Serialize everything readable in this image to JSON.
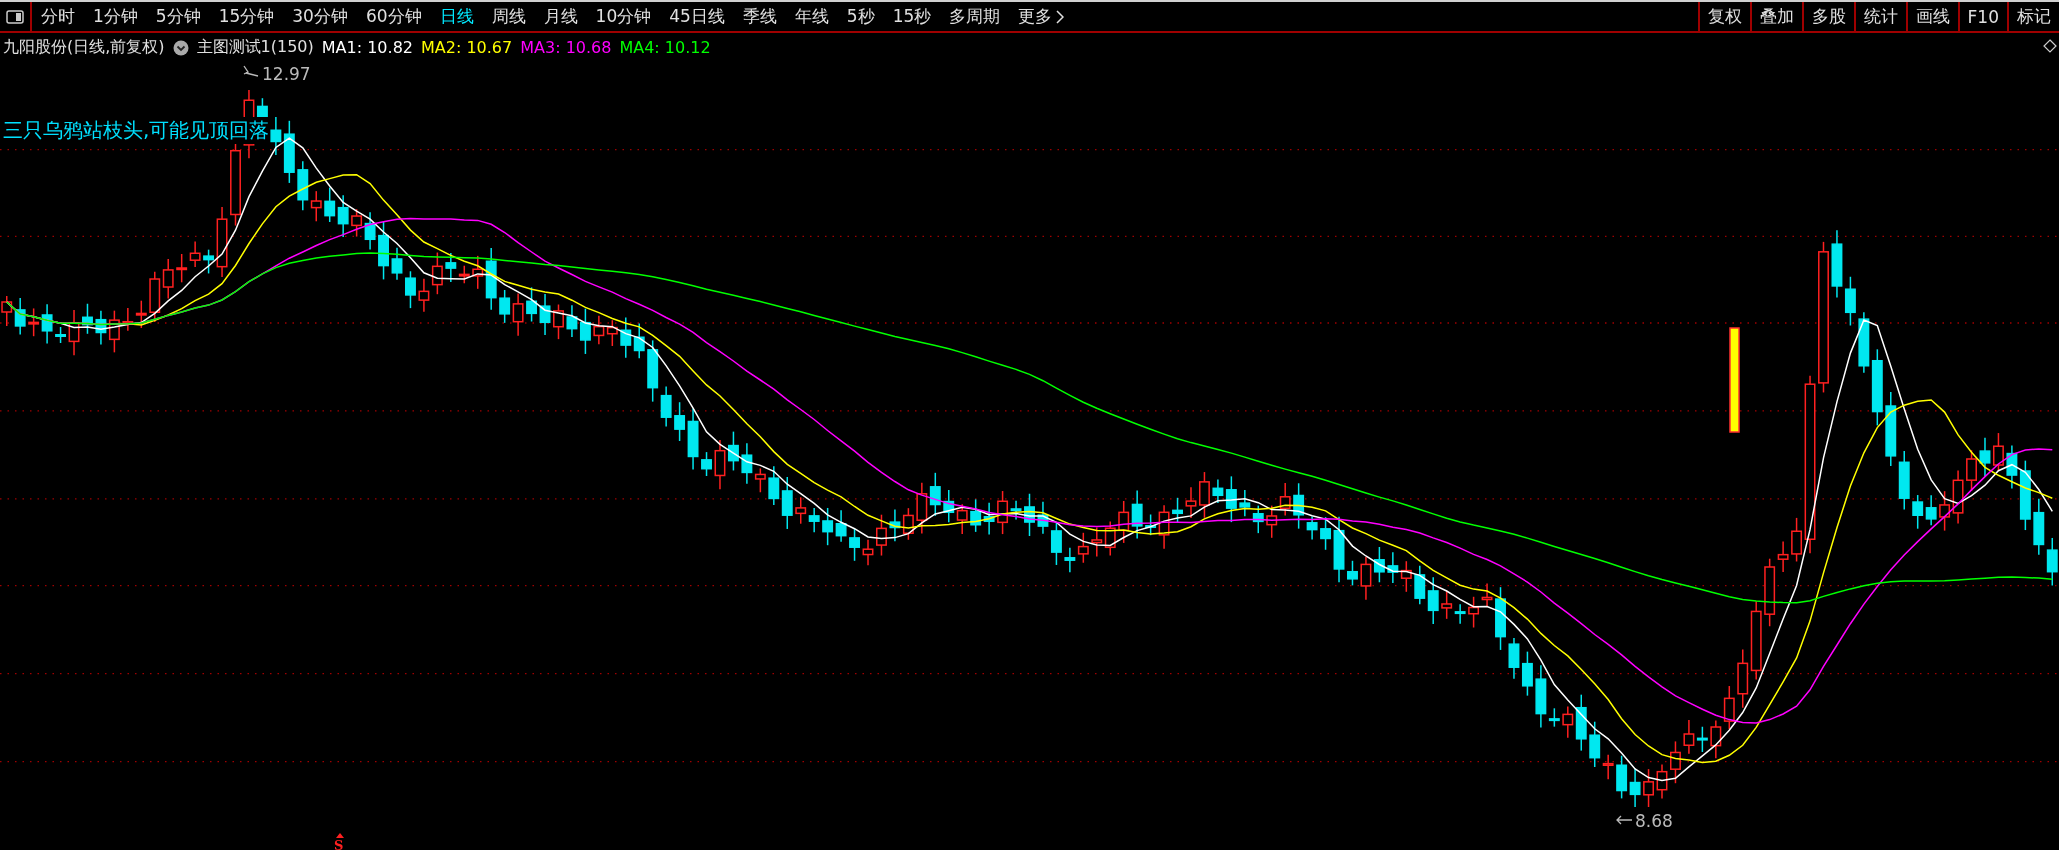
{
  "toolbar": {
    "periods": [
      {
        "label": "分时",
        "selected": false
      },
      {
        "label": "1分钟",
        "selected": false
      },
      {
        "label": "5分钟",
        "selected": false
      },
      {
        "label": "15分钟",
        "selected": false
      },
      {
        "label": "30分钟",
        "selected": false
      },
      {
        "label": "60分钟",
        "selected": false
      },
      {
        "label": "日线",
        "selected": true
      },
      {
        "label": "周线",
        "selected": false
      },
      {
        "label": "月线",
        "selected": false
      },
      {
        "label": "10分钟",
        "selected": false
      },
      {
        "label": "45日线",
        "selected": false
      },
      {
        "label": "季线",
        "selected": false
      },
      {
        "label": "年线",
        "selected": false
      },
      {
        "label": "5秒",
        "selected": false
      },
      {
        "label": "15秒",
        "selected": false
      },
      {
        "label": "多周期",
        "selected": false
      },
      {
        "label": "更多",
        "selected": false
      }
    ],
    "tools": [
      "复权",
      "叠加",
      "多股",
      "统计",
      "画线",
      "F10",
      "标记"
    ]
  },
  "chart": {
    "title": "九阳股份(日线,前复权)",
    "indicator": "主图测试1(150)",
    "moving_averages": [
      {
        "label": "MA1: 10.82",
        "color": "#ffffff"
      },
      {
        "label": "MA2: 10.67",
        "color": "#ffff00"
      },
      {
        "label": "MA3: 10.68",
        "color": "#ff00ff"
      },
      {
        "label": "MA4: 10.12",
        "color": "#00ff00"
      }
    ],
    "signal_text": "三只乌鸦站枝头,可能见顶回落",
    "high_label": "12.97",
    "low_label": "8.68",
    "sell_mark": "S"
  }
}
